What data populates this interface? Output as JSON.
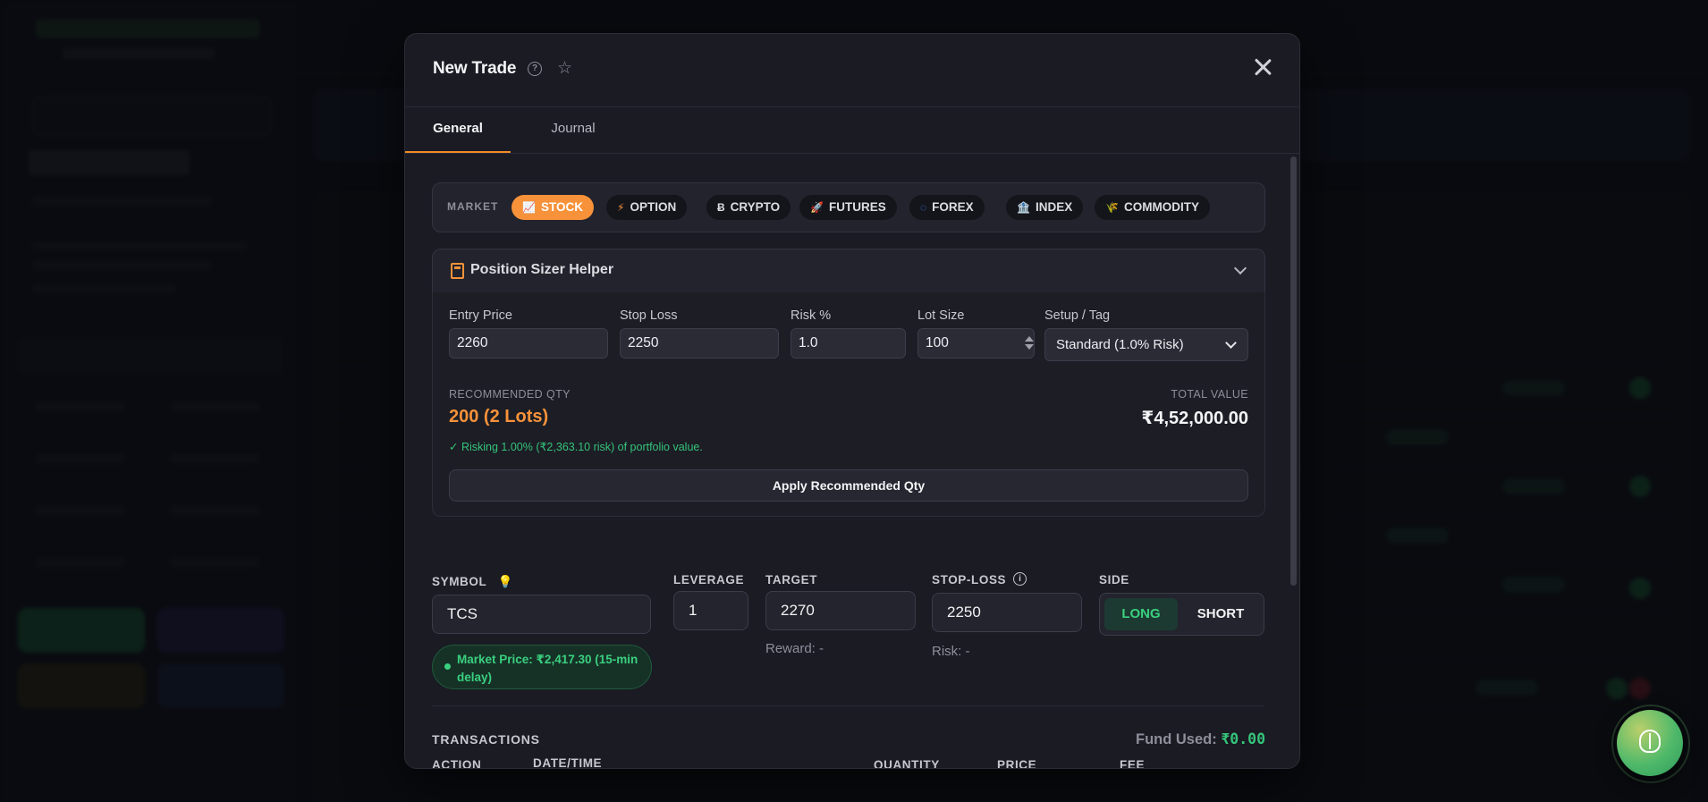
{
  "modal": {
    "title": "New Trade",
    "tabs": [
      "General",
      "Journal"
    ]
  },
  "market": {
    "label": "MARKET",
    "options": [
      {
        "label": "STOCK",
        "icon": "📈",
        "active": true
      },
      {
        "label": "OPTION",
        "icon": "⚡",
        "active": false
      },
      {
        "label": "CRYPTO",
        "icon": "Ƀ",
        "active": false
      },
      {
        "label": "FUTURES",
        "icon": "🚀",
        "active": false
      },
      {
        "label": "FOREX",
        "icon": "◌",
        "active": false
      },
      {
        "label": "INDEX",
        "icon": "🏦",
        "active": false
      },
      {
        "label": "COMMODITY",
        "icon": "🌾",
        "active": false
      }
    ]
  },
  "sizer": {
    "title": "Position Sizer Helper",
    "fields": {
      "entry_label": "Entry Price",
      "entry_value": "2260",
      "stop_label": "Stop Loss",
      "stop_value": "2250",
      "risk_label": "Risk %",
      "risk_value": "1.0",
      "lot_label": "Lot Size",
      "lot_value": "100",
      "setup_label": "Setup / Tag",
      "setup_value": "Standard (1.0% Risk)"
    },
    "recommended_label": "RECOMMENDED QTY",
    "recommended_value": "200 (2 Lots)",
    "total_label": "TOTAL VALUE",
    "total_value": "₹4,52,000.00",
    "risk_note": "✓ Risking 1.00% (₹2,363.10 risk) of portfolio value.",
    "apply_label": "Apply Recommended Qty"
  },
  "trade": {
    "symbol_label": "SYMBOL",
    "symbol_value": "TCS",
    "market_price": "Market Price: ₹2,417.30 (15-min delay)",
    "leverage_label": "LEVERAGE",
    "leverage_value": "1",
    "target_label": "TARGET",
    "target_value": "2270",
    "reward_note": "Reward: -",
    "stoploss_label": "STOP-LOSS",
    "stoploss_value": "2250",
    "risk_note": "Risk: -",
    "side_label": "SIDE",
    "side_long": "LONG",
    "side_short": "SHORT"
  },
  "transactions": {
    "title": "TRANSACTIONS",
    "fund_label": "Fund Used:",
    "fund_value": "₹0.00",
    "headers": [
      "ACTION",
      "DATE/TIME",
      "QUANTITY",
      "PRICE",
      "FEE"
    ]
  },
  "colors": {
    "accent": "#f7923a",
    "positive": "#35c47a",
    "danger": "#e5484d"
  }
}
